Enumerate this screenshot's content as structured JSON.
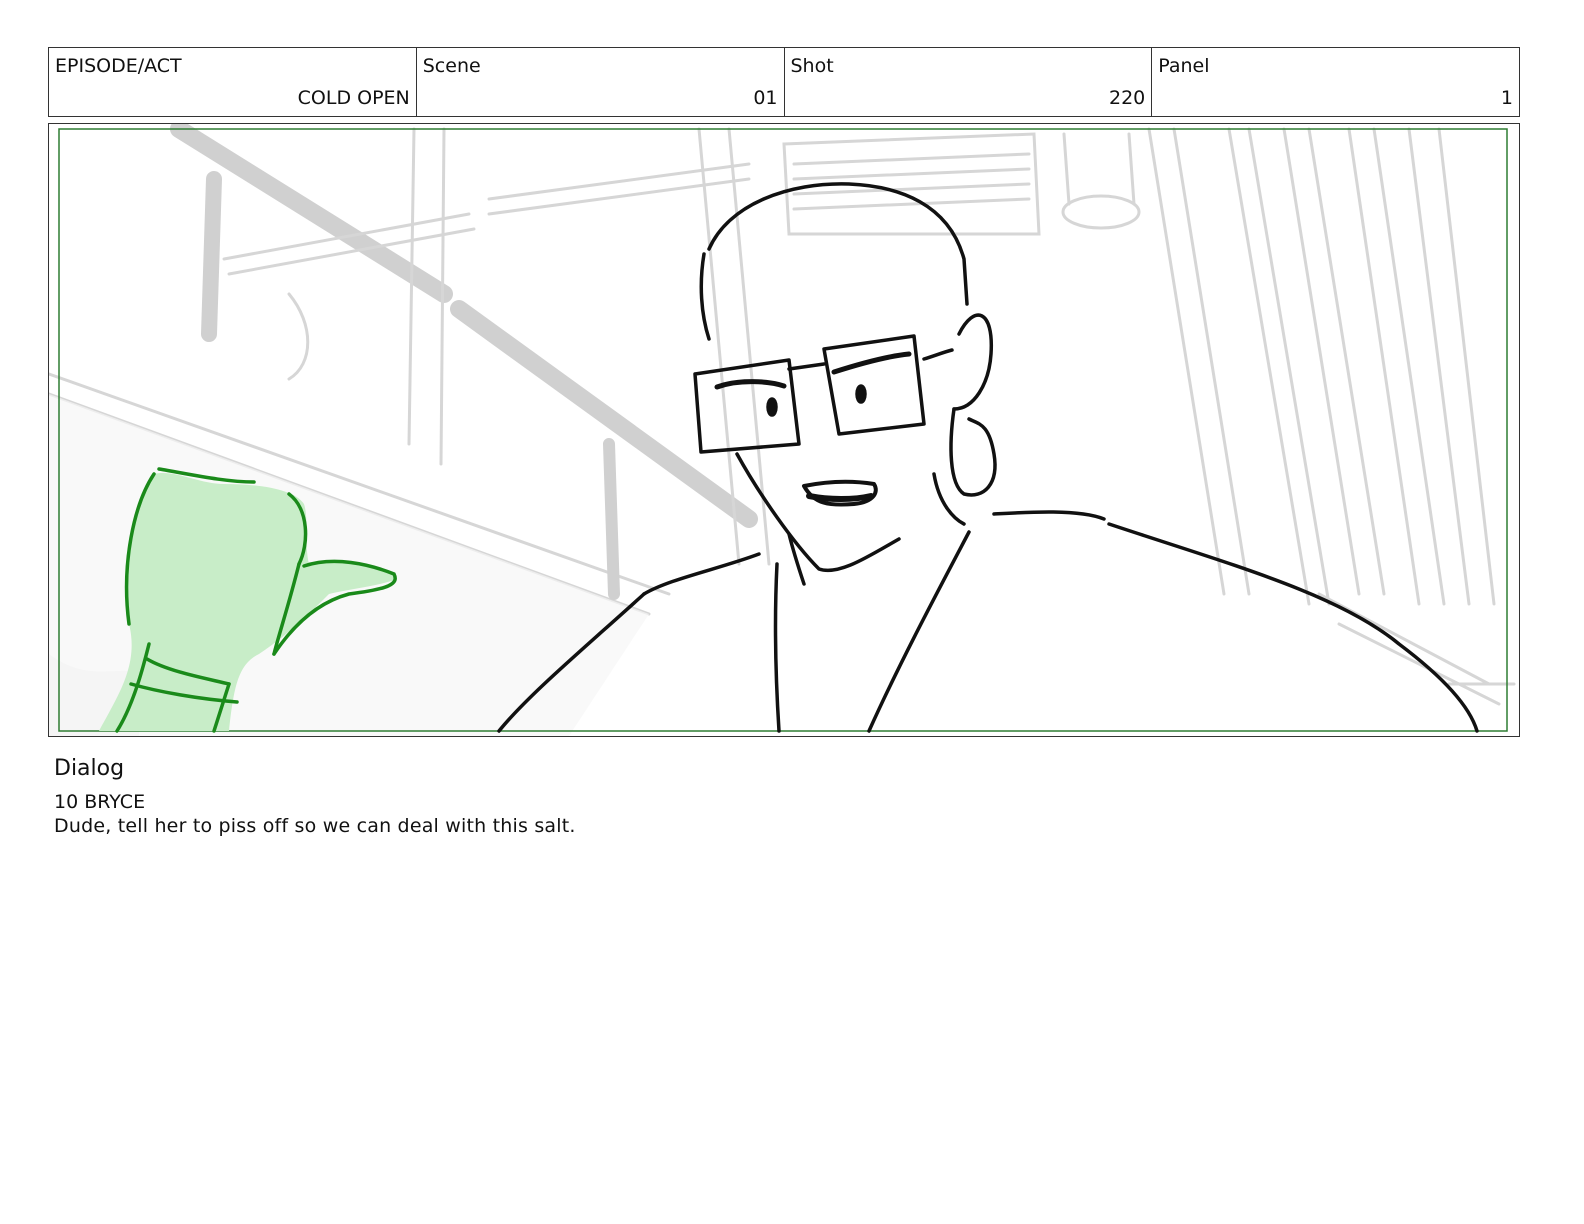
{
  "header": {
    "episode": {
      "label": "EPISODE/ACT",
      "value": "COLD OPEN"
    },
    "scene": {
      "label": "Scene",
      "value": "01"
    },
    "shot": {
      "label": "Shot",
      "value": "220"
    },
    "panel": {
      "label": "Panel",
      "value": "1"
    }
  },
  "panel_image": {
    "description_icon": "storyboard-sketch",
    "colors": {
      "frame": "#2e7d32",
      "highlight": "#c8edc8",
      "ink": "#111111",
      "background_line": "#d9d9d9"
    }
  },
  "dialog": {
    "heading": "Dialog",
    "speaker": "10 BRYCE",
    "line": "Dude, tell her to piss off so we can deal with this salt."
  }
}
